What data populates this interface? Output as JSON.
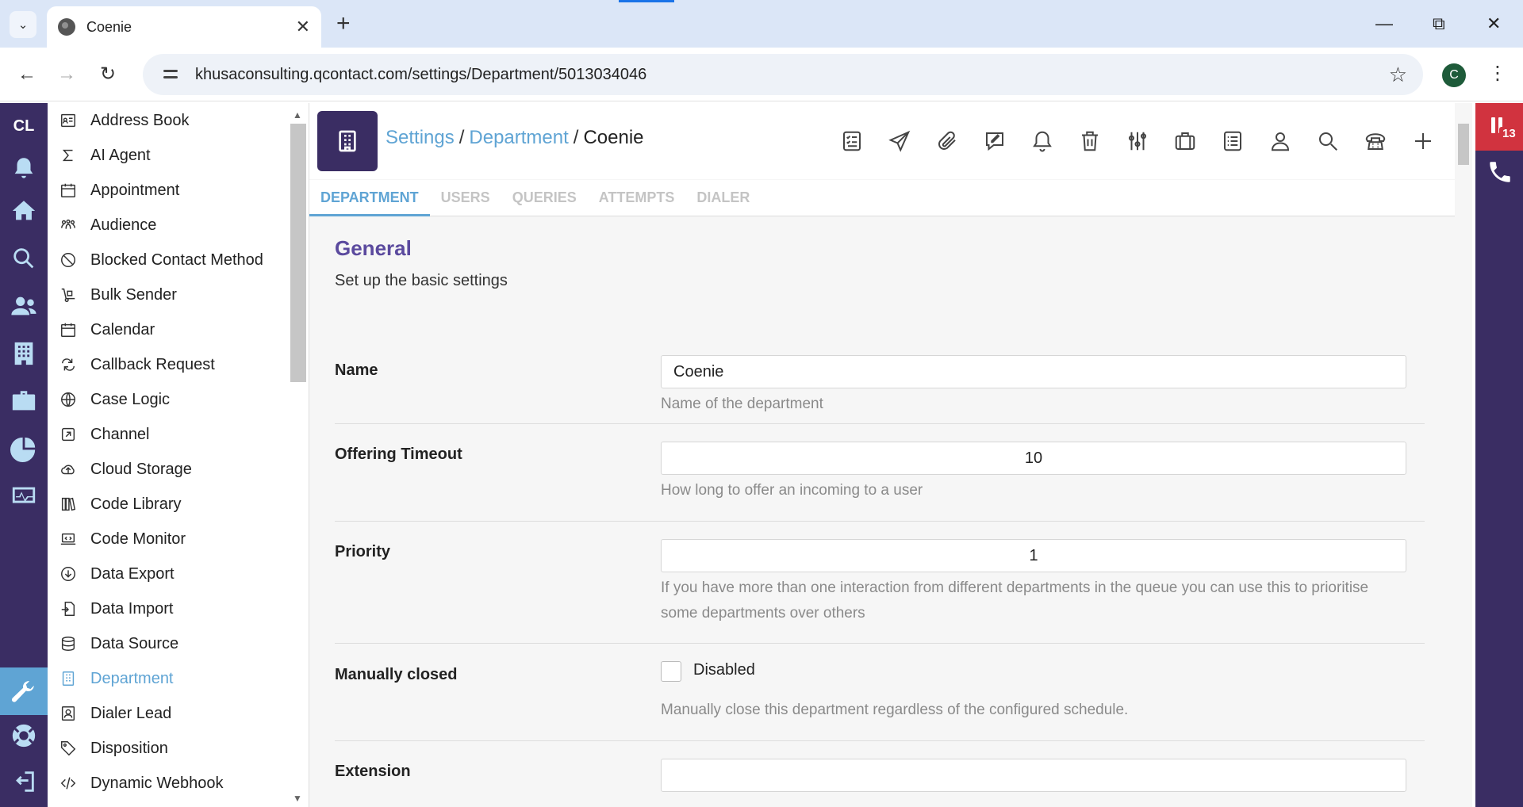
{
  "browser": {
    "tab_title": "Coenie",
    "url": "khusaconsulting.qcontact.com/settings/Department/5013034046",
    "profile_initial": "C"
  },
  "rail": {
    "logo": "CL",
    "icons": [
      "bell-icon",
      "home-icon",
      "search-icon",
      "users-icon",
      "building-icon",
      "briefcase-icon",
      "pie-chart-icon",
      "monitor-icon",
      "wrench-icon",
      "lifebuoy-icon",
      "logout-icon"
    ],
    "active_color": "#5fa4d4"
  },
  "sidebar": {
    "items": [
      {
        "label": "Address Book",
        "icon": "address-book-icon"
      },
      {
        "label": "AI Agent",
        "icon": "sigma-icon"
      },
      {
        "label": "Appointment",
        "icon": "calendar-icon"
      },
      {
        "label": "Audience",
        "icon": "people-icon"
      },
      {
        "label": "Blocked Contact Method",
        "icon": "block-icon"
      },
      {
        "label": "Bulk Sender",
        "icon": "dolly-icon"
      },
      {
        "label": "Calendar",
        "icon": "calendar-icon"
      },
      {
        "label": "Callback Request",
        "icon": "repeat-icon"
      },
      {
        "label": "Case Logic",
        "icon": "globe-icon"
      },
      {
        "label": "Channel",
        "icon": "external-link-icon"
      },
      {
        "label": "Cloud Storage",
        "icon": "cloud-upload-icon"
      },
      {
        "label": "Code Library",
        "icon": "books-icon"
      },
      {
        "label": "Code Monitor",
        "icon": "laptop-code-icon"
      },
      {
        "label": "Data Export",
        "icon": "download-icon"
      },
      {
        "label": "Data Import",
        "icon": "file-import-icon"
      },
      {
        "label": "Data Source",
        "icon": "database-icon"
      },
      {
        "label": "Department",
        "icon": "building-icon",
        "active": true
      },
      {
        "label": "Dialer Lead",
        "icon": "contact-card-icon"
      },
      {
        "label": "Disposition",
        "icon": "tag-icon"
      },
      {
        "label": "Dynamic Webhook",
        "icon": "code-icon"
      }
    ]
  },
  "header": {
    "breadcrumb": {
      "settings": "Settings",
      "department": "Department",
      "current": "Coenie",
      "sep": "/"
    },
    "toolbar_icons": [
      "task-list-icon",
      "send-icon",
      "paperclip-icon",
      "note-icon",
      "bell-icon",
      "trash-icon",
      "sliders-icon",
      "briefcase-icon",
      "list-icon",
      "user-icon",
      "search-icon",
      "phone-icon",
      "plus-icon"
    ]
  },
  "tabs": [
    {
      "label": "DEPARTMENT",
      "active": true
    },
    {
      "label": "USERS",
      "active": false
    },
    {
      "label": "QUERIES",
      "active": false
    },
    {
      "label": "ATTEMPTS",
      "active": false
    },
    {
      "label": "DIALER",
      "active": false
    }
  ],
  "form": {
    "title": "General",
    "subtitle": "Set up the basic settings",
    "name": {
      "label": "Name",
      "value": "Coenie",
      "help": "Name of the department"
    },
    "timeout": {
      "label": "Offering Timeout",
      "value": "10",
      "help": "How long to offer an incoming to a user"
    },
    "priority": {
      "label": "Priority",
      "value": "1",
      "help": "If you have more than one interaction from different departments in the queue you can use this to prioritise some departments over others"
    },
    "manually_closed": {
      "label": "Manually closed",
      "checkbox_label": "Disabled",
      "checked": false,
      "help": "Manually close this department regardless of the configured schedule."
    },
    "extension": {
      "label": "Extension",
      "value": ""
    }
  },
  "right_rail": {
    "badge": "13",
    "accent": "#d1333f"
  },
  "colors": {
    "brand_purple": "#3a2d63",
    "accent_blue": "#5fa4d4",
    "title_purple": "#5b4a9e"
  }
}
